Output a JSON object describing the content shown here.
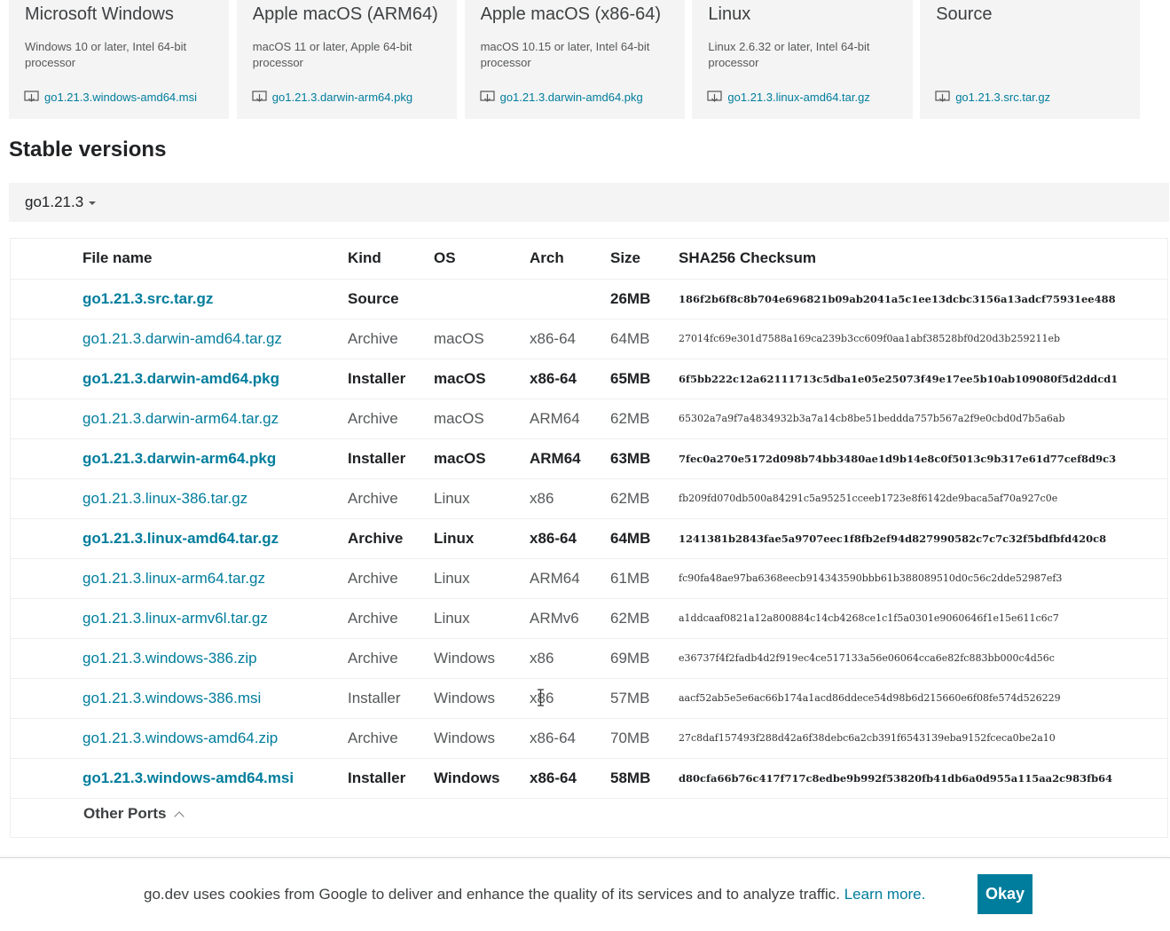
{
  "featured": [
    {
      "title": "Microsoft Windows",
      "desc": "Windows 10 or later, Intel 64-bit processor",
      "file": "go1.21.3.windows-amd64.msi"
    },
    {
      "title": "Apple macOS (ARM64)",
      "desc": "macOS 11 or later, Apple 64-bit processor",
      "file": "go1.21.3.darwin-arm64.pkg"
    },
    {
      "title": "Apple macOS (x86-64)",
      "desc": "macOS 10.15 or later, Intel 64-bit processor",
      "file": "go1.21.3.darwin-amd64.pkg"
    },
    {
      "title": "Linux",
      "desc": "Linux 2.6.32 or later, Intel 64-bit processor",
      "file": "go1.21.3.linux-amd64.tar.gz"
    },
    {
      "title": "Source",
      "desc": "",
      "file": "go1.21.3.src.tar.gz"
    }
  ],
  "section_title": "Stable versions",
  "version_selector": "go1.21.3",
  "table": {
    "headers": {
      "file": "File name",
      "kind": "Kind",
      "os": "OS",
      "arch": "Arch",
      "size": "Size",
      "sha": "SHA256 Checksum"
    },
    "rows": [
      {
        "file": "go1.21.3.src.tar.gz",
        "kind": "Source",
        "os": "",
        "arch": "",
        "size": "26MB",
        "sha": "186f2b6f8c8b704e696821b09ab2041a5c1ee13dcbc3156a13adcf75931ee488",
        "highlight": true
      },
      {
        "file": "go1.21.3.darwin-amd64.tar.gz",
        "kind": "Archive",
        "os": "macOS",
        "arch": "x86-64",
        "size": "64MB",
        "sha": "27014fc69e301d7588a169ca239b3cc609f0aa1abf38528bf0d20d3b259211eb",
        "highlight": false
      },
      {
        "file": "go1.21.3.darwin-amd64.pkg",
        "kind": "Installer",
        "os": "macOS",
        "arch": "x86-64",
        "size": "65MB",
        "sha": "6f5bb222c12a62111713c5dba1e05e25073f49e17ee5b10ab109080f5d2ddcd1",
        "highlight": true
      },
      {
        "file": "go1.21.3.darwin-arm64.tar.gz",
        "kind": "Archive",
        "os": "macOS",
        "arch": "ARM64",
        "size": "62MB",
        "sha": "65302a7a9f7a4834932b3a7a14cb8be51beddda757b567a2f9e0cbd0d7b5a6ab",
        "highlight": false
      },
      {
        "file": "go1.21.3.darwin-arm64.pkg",
        "kind": "Installer",
        "os": "macOS",
        "arch": "ARM64",
        "size": "63MB",
        "sha": "7fec0a270e5172d098b74bb3480ae1d9b14e8c0f5013c9b317e61d77cef8d9c3",
        "highlight": true
      },
      {
        "file": "go1.21.3.linux-386.tar.gz",
        "kind": "Archive",
        "os": "Linux",
        "arch": "x86",
        "size": "62MB",
        "sha": "fb209fd070db500a84291c5a95251cceeb1723e8f6142de9baca5af70a927c0e",
        "highlight": false
      },
      {
        "file": "go1.21.3.linux-amd64.tar.gz",
        "kind": "Archive",
        "os": "Linux",
        "arch": "x86-64",
        "size": "64MB",
        "sha": "1241381b2843fae5a9707eec1f8fb2ef94d827990582c7c7c32f5bdfbfd420c8",
        "highlight": true
      },
      {
        "file": "go1.21.3.linux-arm64.tar.gz",
        "kind": "Archive",
        "os": "Linux",
        "arch": "ARM64",
        "size": "61MB",
        "sha": "fc90fa48ae97ba6368eecb914343590bbb61b388089510d0c56c2dde52987ef3",
        "highlight": false
      },
      {
        "file": "go1.21.3.linux-armv6l.tar.gz",
        "kind": "Archive",
        "os": "Linux",
        "arch": "ARMv6",
        "size": "62MB",
        "sha": "a1ddcaaf0821a12a800884c14cb4268ce1c1f5a0301e9060646f1e15e611c6c7",
        "highlight": false
      },
      {
        "file": "go1.21.3.windows-386.zip",
        "kind": "Archive",
        "os": "Windows",
        "arch": "x86",
        "size": "69MB",
        "sha": "e36737f4f2fadb4d2f919ec4ce517133a56e06064cca6e82fc883bb000c4d56c",
        "highlight": false
      },
      {
        "file": "go1.21.3.windows-386.msi",
        "kind": "Installer",
        "os": "Windows",
        "arch": "x86",
        "size": "57MB",
        "sha": "aacf52ab5e5e6ac66b174a1acd86ddece54d98b6d215660e6f08fe574d526229",
        "highlight": false
      },
      {
        "file": "go1.21.3.windows-amd64.zip",
        "kind": "Archive",
        "os": "Windows",
        "arch": "x86-64",
        "size": "70MB",
        "sha": "27c8daf157493f288d42a6f38debc6a2cb391f6543139eba9152fceca0be2a10",
        "highlight": false
      },
      {
        "file": "go1.21.3.windows-amd64.msi",
        "kind": "Installer",
        "os": "Windows",
        "arch": "x86-64",
        "size": "58MB",
        "sha": "d80cfa66b76c417f717c8edbe9b992f53820fb41db6a0d955a115aa2c983fb64",
        "highlight": true
      }
    ]
  },
  "other_ports": "Other Ports",
  "cookie": {
    "text": "go.dev uses cookies from Google to deliver and enhance the quality of its services and to analyze traffic.",
    "learn_more": "Learn more.",
    "okay": "Okay"
  },
  "colors": {
    "link": "#007d9c",
    "card_bg": "#f4f4f4",
    "button": "#007d9c"
  },
  "icons": {
    "download": "download-icon",
    "version_caret": "caret-down-icon",
    "other_ports": "chevron-up-icon"
  }
}
